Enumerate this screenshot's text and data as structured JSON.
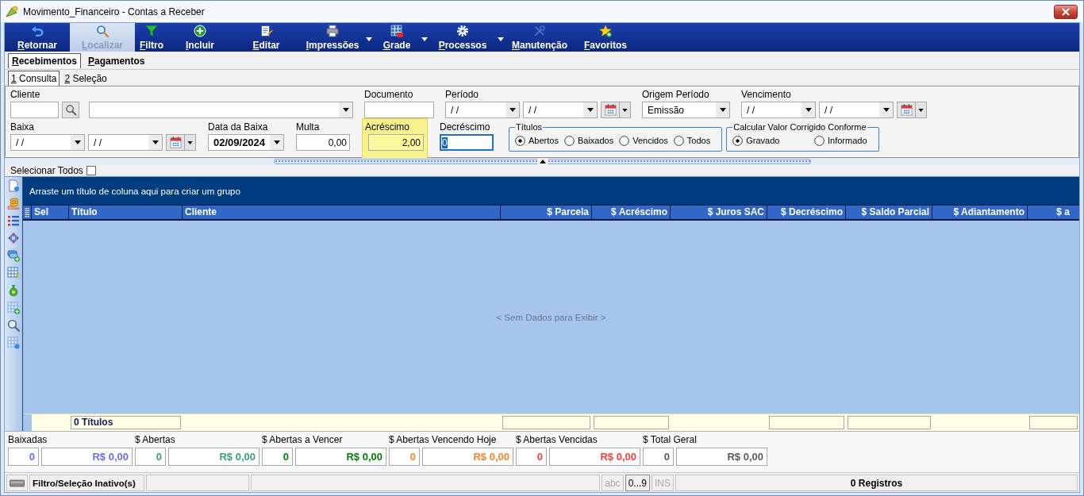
{
  "window": {
    "title": "Movimento_Financeiro - Contas a Receber"
  },
  "toolbar": [
    {
      "label": "Retornar",
      "hovered": false,
      "has_menu": false
    },
    {
      "label": "Localizar",
      "hovered": true,
      "has_menu": false
    },
    {
      "label": "Filtro",
      "hovered": false,
      "has_menu": false
    },
    {
      "label": "Incluir",
      "hovered": false,
      "has_menu": false
    },
    {
      "label": "Editar",
      "hovered": false,
      "has_menu": false
    },
    {
      "label": "Impressões",
      "hovered": false,
      "has_menu": true
    },
    {
      "label": "Grade",
      "hovered": false,
      "has_menu": true
    },
    {
      "label": "Processos",
      "hovered": false,
      "has_menu": true
    },
    {
      "label": "Manutenção",
      "hovered": false,
      "has_menu": false
    },
    {
      "label": "Favoritos",
      "hovered": false,
      "has_menu": false
    }
  ],
  "tabs": [
    {
      "label": "Recebimentos",
      "selected": true
    },
    {
      "label": "Pagamentos",
      "selected": false
    }
  ],
  "subtabs": [
    {
      "label": "1 Consulta",
      "selected": true
    },
    {
      "label": "2 Seleção",
      "selected": false
    }
  ],
  "filters": {
    "row_1": [
      {
        "label": "Cliente",
        "highlighted": false,
        "controls": [
          {
            "kind": "code"
          },
          {
            "kind": "search"
          },
          {
            "kind": "name_combo"
          }
        ]
      },
      {
        "label": "Documento",
        "highlighted": false,
        "controls": [
          {
            "kind": "text"
          }
        ]
      },
      {
        "label": "Período",
        "highlighted": false,
        "controls": [
          {
            "kind": "date",
            "value": "/ /"
          },
          {
            "kind": "date",
            "value": "/ /"
          },
          {
            "kind": "calendar"
          }
        ]
      },
      {
        "label": "Origem Período",
        "highlighted": false,
        "controls": [
          {
            "kind": "select",
            "value": "Emissão"
          }
        ]
      },
      {
        "label": "Vencimento",
        "highlighted": false,
        "controls": [
          {
            "kind": "date",
            "value": "/ /"
          },
          {
            "kind": "date",
            "value": "/ /"
          },
          {
            "kind": "calendar"
          }
        ]
      }
    ],
    "row_2": [
      {
        "label": "Baixa",
        "highlighted": false,
        "controls": [
          {
            "kind": "date",
            "value": "/ /"
          },
          {
            "kind": "date",
            "value": "/ /"
          },
          {
            "kind": "calendar"
          }
        ]
      },
      {
        "label": "Data da Baixa",
        "highlighted": false,
        "controls": [
          {
            "kind": "date_value",
            "value": "02/09/2024"
          }
        ]
      },
      {
        "label": "Multa",
        "highlighted": false,
        "controls": [
          {
            "kind": "amount",
            "value": "0,00",
            "focused": false
          }
        ]
      },
      {
        "label": "Acréscimo",
        "highlighted": true,
        "controls": [
          {
            "kind": "amount",
            "value": "2,00",
            "focused": false
          }
        ]
      },
      {
        "label": "Decréscimo",
        "highlighted": false,
        "controls": [
          {
            "kind": "amount",
            "value": "0",
            "focused": true
          }
        ]
      }
    ],
    "option_groups": [
      {
        "legend": "Títulos",
        "options": [
          {
            "label": "Abertos",
            "selected": true
          },
          {
            "label": "Baixados",
            "selected": false
          },
          {
            "label": "Vencidos",
            "selected": false
          },
          {
            "label": "Todos",
            "selected": false
          }
        ]
      },
      {
        "legend": "Calcular Valor Corrigido Conforme",
        "options": [
          {
            "label": "Gravado",
            "selected": true
          },
          {
            "label": "Informado",
            "selected": false
          }
        ]
      }
    ]
  },
  "select_all": {
    "label": "Selecionar Todos",
    "checked": false
  },
  "grid": {
    "group_panel": "Arraste um título de coluna aqui para criar um grupo",
    "columns": [
      {
        "label": "Sel",
        "kind": "text",
        "total_box": false
      },
      {
        "label": "Título",
        "kind": "text",
        "total_box": true,
        "total": "0 Títulos"
      },
      {
        "label": "Cliente",
        "kind": "text",
        "total_box": false
      },
      {
        "label": "$ Parcela",
        "kind": "money",
        "total_box": true
      },
      {
        "label": "$ Acréscimo",
        "kind": "money",
        "total_box": true
      },
      {
        "label": "$ Juros SAC",
        "kind": "money",
        "total_box": false
      },
      {
        "label": "$ Decréscimo",
        "kind": "money",
        "total_box": true
      },
      {
        "label": "$ Saldo Parcial",
        "kind": "money",
        "total_box": true
      },
      {
        "label": "$ Adiantamento",
        "kind": "money",
        "total_box": false
      },
      {
        "label": "$ a",
        "kind": "money",
        "total_box": true
      }
    ],
    "empty_text": "< Sem Dados para Exibir >"
  },
  "totals": [
    {
      "label": "Baixadas",
      "count": "0",
      "amount": "R$ 0,00",
      "color": "#6b6bff"
    },
    {
      "label": "$ Abertas",
      "count": "0",
      "amount": "R$ 0,00",
      "color": "#3a9f78"
    },
    {
      "label": "$ Abertas a Vencer",
      "count": "0",
      "amount": "R$ 0,00",
      "color": "#008000"
    },
    {
      "label": "$ Abertas Vencendo Hoje",
      "count": "0",
      "amount": "R$ 0,00",
      "color": "#ff7f2a"
    },
    {
      "label": "$ Abertas Vencidas",
      "count": "0",
      "amount": "R$ 0,00",
      "color": "#ff3b3b"
    },
    {
      "label": "$ Total Geral",
      "count": "0",
      "amount": "R$ 0,00",
      "color": "#5a5a5a"
    }
  ],
  "status_bar": {
    "filter_status": "Filtro/Seleção Inativo(s)",
    "indicators": [
      {
        "label": "abc",
        "active": false
      },
      {
        "label": "0...9",
        "active": true
      },
      {
        "label": "INS",
        "active": false
      }
    ],
    "records": "0 Registros"
  }
}
